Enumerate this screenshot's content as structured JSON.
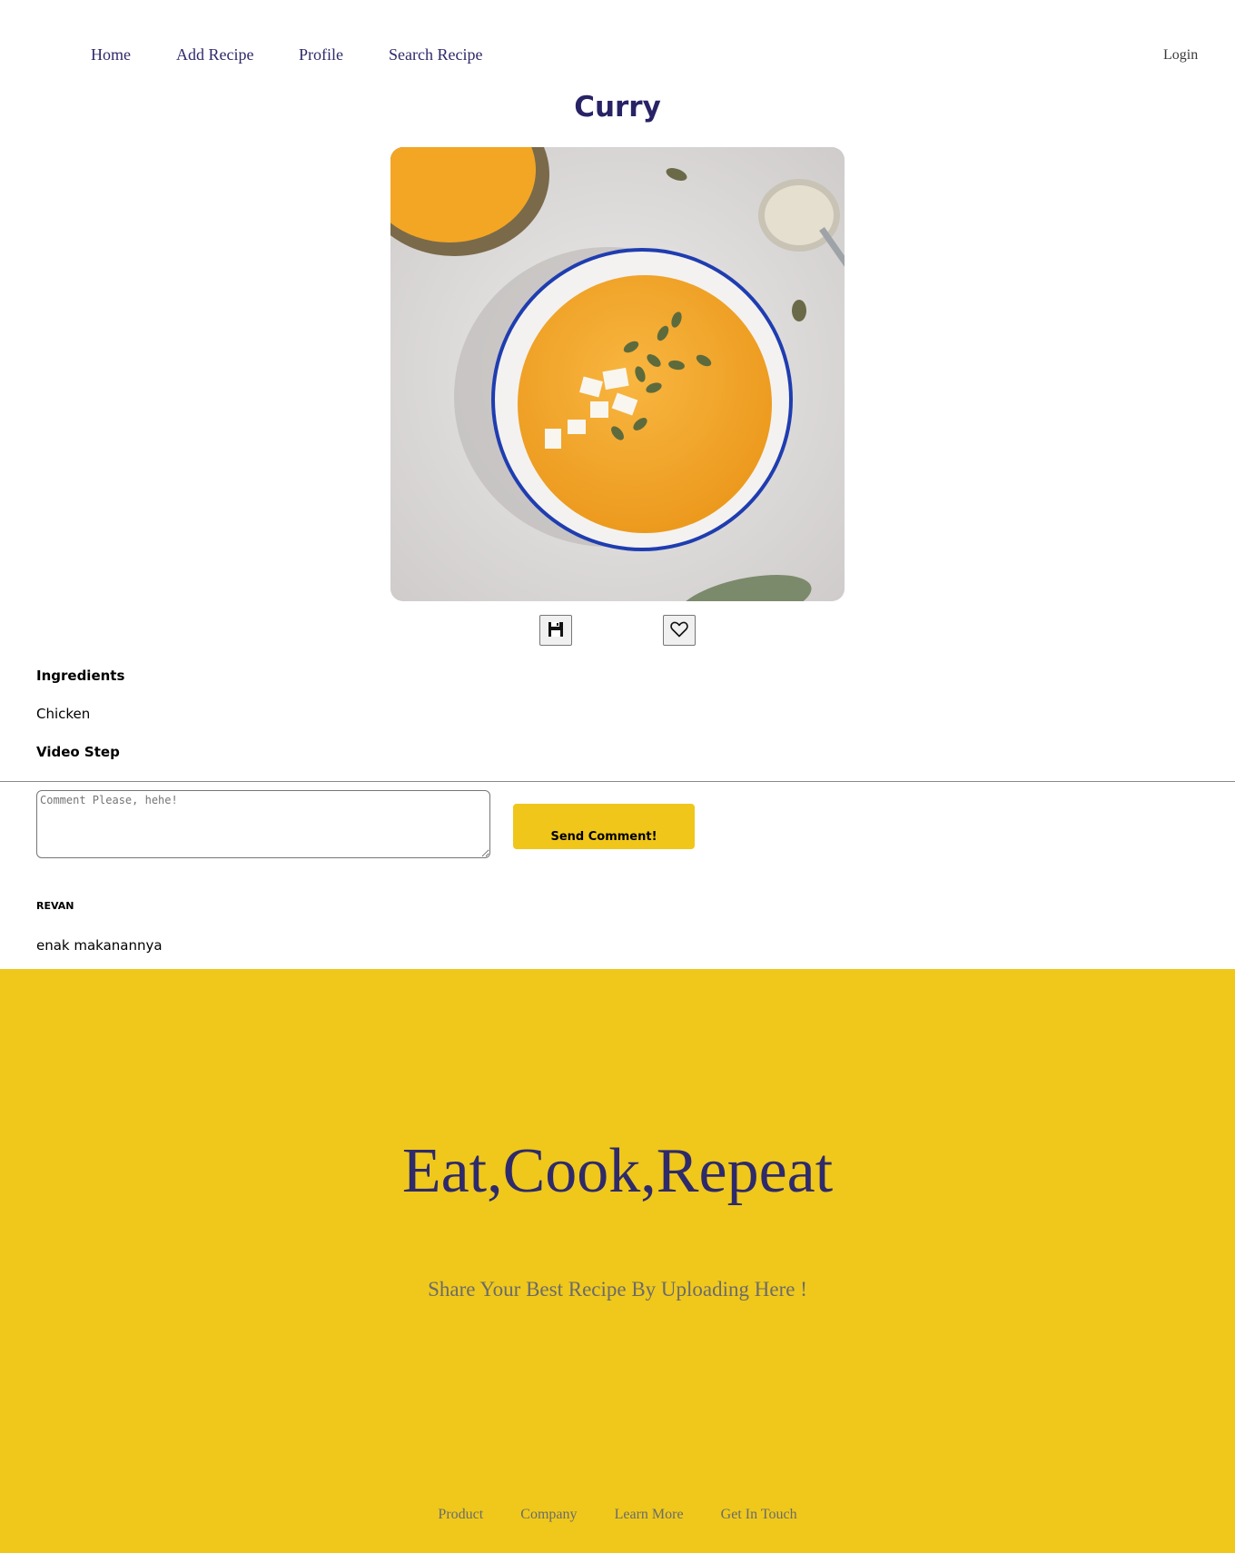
{
  "nav": {
    "home": "Home",
    "add_recipe": "Add Recipe",
    "profile": "Profile",
    "search_recipe": "Search Recipe",
    "login": "Login"
  },
  "recipe": {
    "title": "Curry",
    "photo_icon": "soup-bowl-photo"
  },
  "actions": {
    "save_icon": "floppy-disk-icon",
    "like_icon": "heart-icon"
  },
  "details": {
    "ingredients_label": "Ingredients",
    "ingredients_value": "Chicken",
    "video_label": "Video Step"
  },
  "comment_form": {
    "placeholder": "Comment Please, hehe!",
    "value": "",
    "send_label": "Send Comment!"
  },
  "comments": [
    {
      "user": "REVAN",
      "text": "enak makanannya"
    }
  ],
  "footer": {
    "title": "Eat,Cook,Repeat",
    "subtitle": "Share Your Best Recipe By Uploading Here !",
    "links": [
      "Product",
      "Company",
      "Learn More",
      "Get In Touch"
    ]
  },
  "colors": {
    "accent_yellow": "#efc81b",
    "brand_navy": "#2e2a6b"
  }
}
